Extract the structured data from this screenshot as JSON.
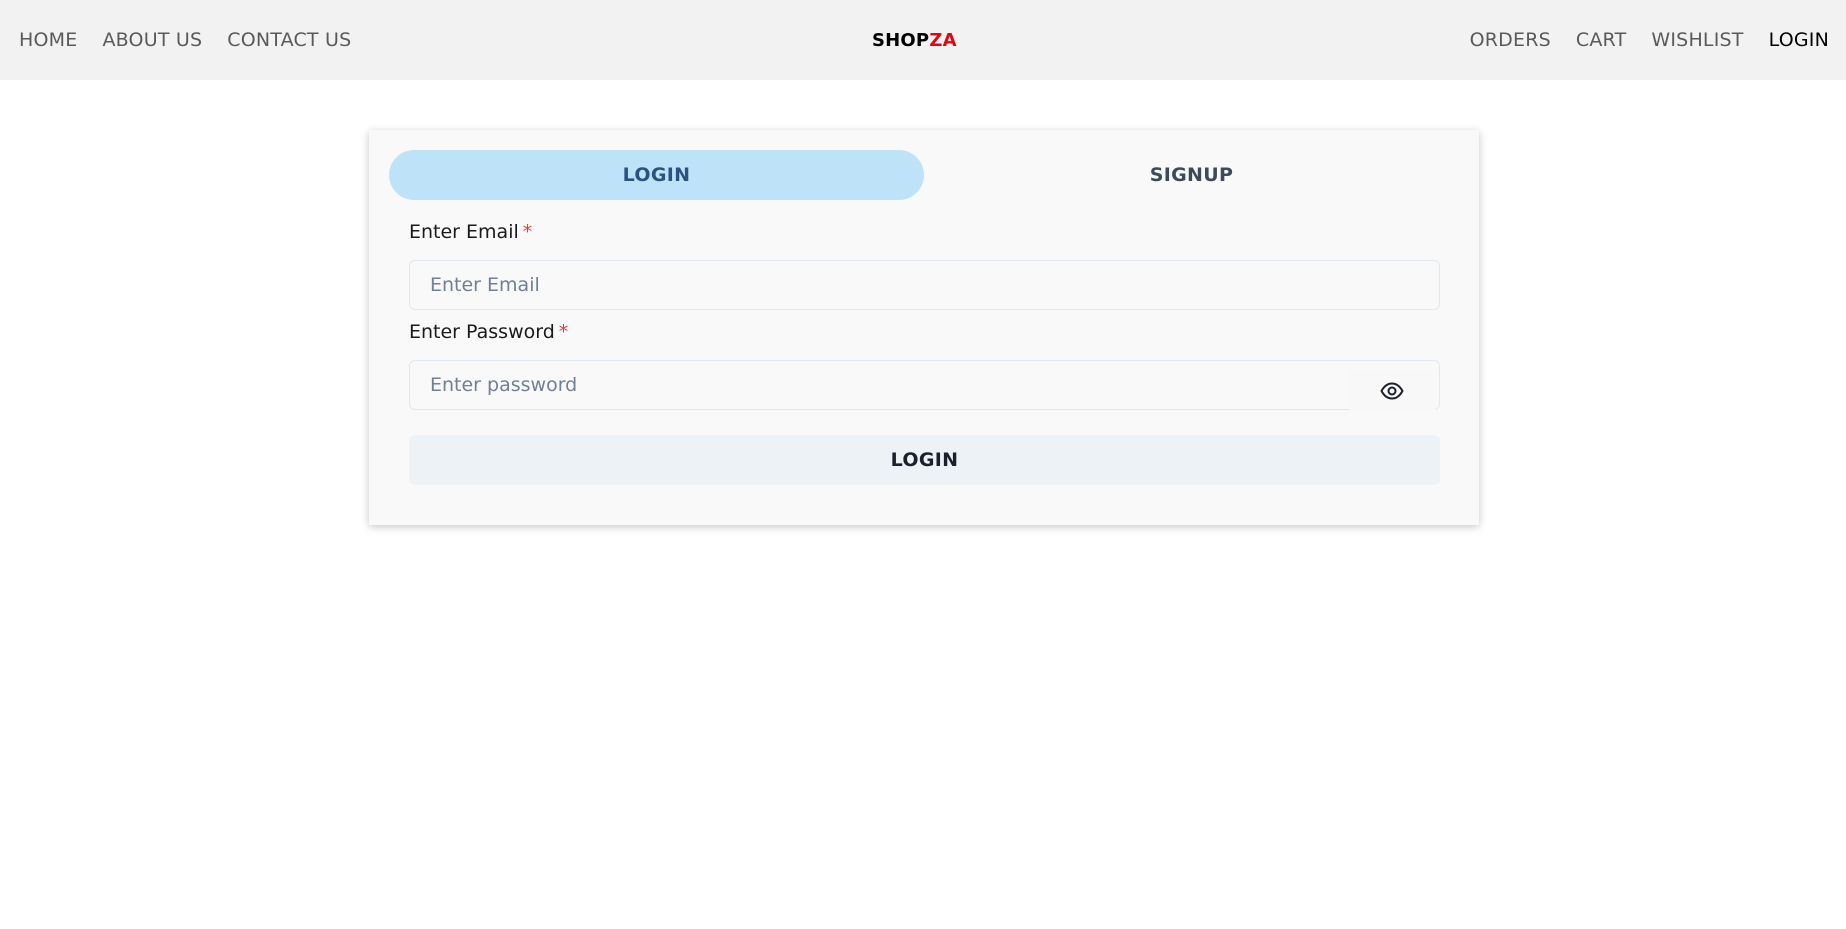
{
  "nav": {
    "left": [
      "HOME",
      "ABOUT US",
      "CONTACT US"
    ],
    "brand": {
      "part1": "SHOP",
      "part2": "ZA"
    },
    "right": [
      "ORDERS",
      "CART",
      "WISHLIST",
      "LOGIN"
    ],
    "active": "LOGIN"
  },
  "auth": {
    "tabs": [
      "LOGIN",
      "SIGNUP"
    ],
    "selected_tab": "LOGIN",
    "email": {
      "label": "Enter Email",
      "required_mark": "*",
      "placeholder": "Enter Email",
      "value": ""
    },
    "password": {
      "label": "Enter Password",
      "required_mark": "*",
      "placeholder": "Enter password",
      "value": "",
      "toggle_icon": "eye-icon"
    },
    "submit_label": "LOGIN"
  },
  "colors": {
    "nav_bg": "#f2f2f2",
    "brand_accent": "#e30613",
    "tab_selected_bg": "#bee3f8",
    "tab_selected_text": "#2c5282",
    "required": "#e53e3e"
  }
}
